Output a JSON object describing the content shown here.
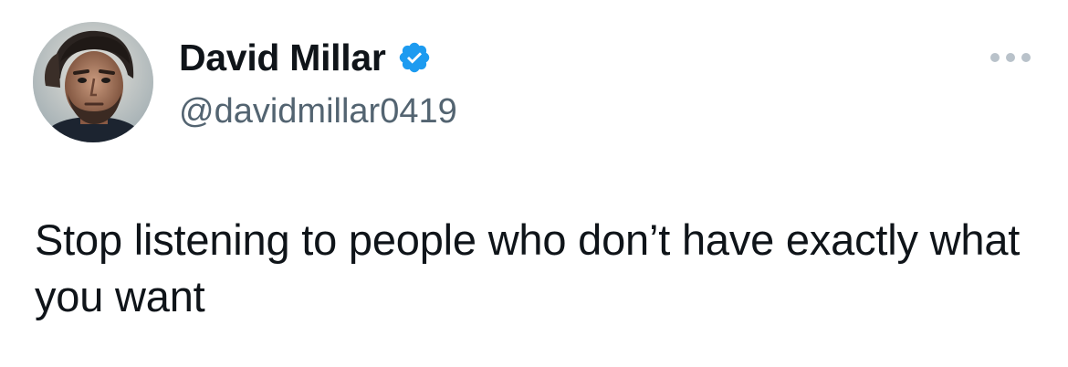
{
  "author": {
    "display_name": "David Millar",
    "handle": "@davidmillar0419",
    "verified": true,
    "avatar_icon": "profile-photo"
  },
  "tweet": {
    "text": "Stop listening to people who don’t have exactly what you want"
  },
  "menu": {
    "icon": "more-horizontal-icon"
  },
  "colors": {
    "text_primary": "#0f1419",
    "text_secondary": "#536471",
    "verified_blue": "#1d9bf0",
    "background": "#ffffff"
  }
}
